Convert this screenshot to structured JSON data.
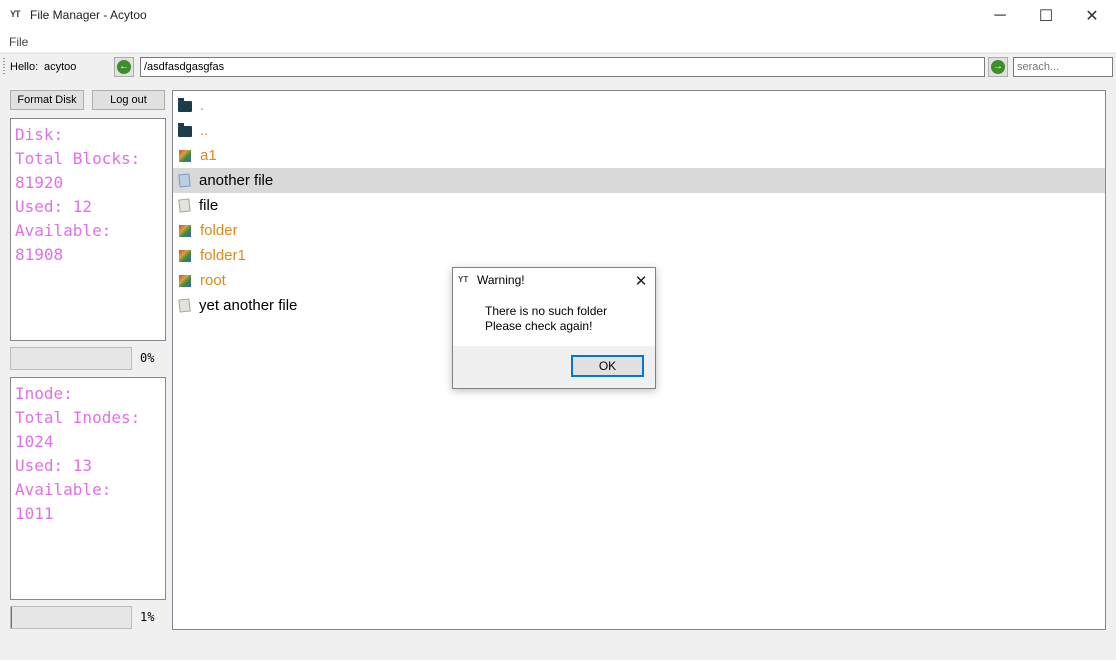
{
  "window": {
    "app_icon": "YT",
    "title": "File Manager - Acytoo",
    "minimize": "─",
    "maximize": "☐",
    "close": "✕"
  },
  "menubar": {
    "file": "File"
  },
  "toolbar": {
    "hello": "Hello:",
    "username": "acytoo",
    "back_icon": "arrow-left-icon",
    "back_glyph": "←",
    "path": "/asdfasdgasgfas",
    "go_icon": "arrow-right-icon",
    "go_glyph": "→",
    "search_placeholder": "serach..."
  },
  "sidebar": {
    "format_button": "Format Disk",
    "logout_button": "Log out",
    "disk": {
      "line1": "Disk:",
      "line2": "Total Blocks:",
      "line3": "81920",
      "line4": "Used: 12",
      "line5": "Available:",
      "line6": "81908",
      "progress_label": "0%",
      "progress_value": 0
    },
    "inode": {
      "line1": "Inode:",
      "line2": "Total Inodes:",
      "line3": "1024",
      "line4": "Used: 13",
      "line5": "Available:",
      "line6": "1011",
      "progress_label": "1%",
      "progress_value": 1
    }
  },
  "files": [
    {
      "name": ".",
      "kind": "dir",
      "icon": "folder-icon"
    },
    {
      "name": "..",
      "kind": "dir",
      "icon": "folder-icon"
    },
    {
      "name": "a1",
      "kind": "dir",
      "icon": "package-icon"
    },
    {
      "name": "another file",
      "kind": "reg",
      "icon": "document-icon",
      "selected": true
    },
    {
      "name": "file",
      "kind": "reg",
      "icon": "document-icon"
    },
    {
      "name": "folder",
      "kind": "dir",
      "icon": "package-icon"
    },
    {
      "name": "folder1",
      "kind": "dir",
      "icon": "package-icon"
    },
    {
      "name": "root",
      "kind": "dir",
      "icon": "package-icon"
    },
    {
      "name": "yet another file",
      "kind": "reg",
      "icon": "document-icon"
    }
  ],
  "dialog": {
    "icon": "YT",
    "title": "Warning!",
    "close": "✕",
    "message_line1": "There is no such folder",
    "message_line2": "Please check again!",
    "ok": "OK"
  },
  "colors": {
    "accent": "#0078d7",
    "info_text": "#e46ee8",
    "dir_text": "#de8a16",
    "selected_row": "#d9d9d9",
    "progress_fill": "#06b025"
  }
}
